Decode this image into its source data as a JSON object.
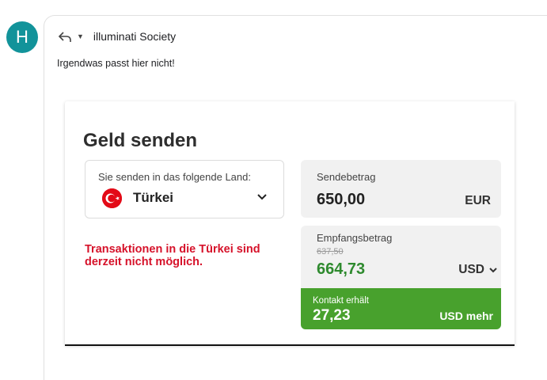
{
  "avatar": {
    "initial": "H",
    "color": "#12939a"
  },
  "header": {
    "recipient": "illuminati Society",
    "reply_icon": "reply-icon",
    "dropdown_icon": "caret-down-icon"
  },
  "message": {
    "text": "Irgendwas passt hier nicht!"
  },
  "transfer": {
    "title": "Geld senden",
    "country_label": "Sie senden in das folgende Land:",
    "country_name": "Türkei",
    "country_flag": "turkey-flag-icon",
    "error": "Transaktionen in die Türkei sind derzeit nicht möglich.",
    "error_color": "#d6122a",
    "send": {
      "label": "Sendebetrag",
      "amount": "650,00",
      "currency": "EUR"
    },
    "receive": {
      "label": "Empfangsbetrag",
      "old_amount": "637,50",
      "amount": "664,73",
      "amount_color": "#2e8a2e",
      "currency": "USD"
    },
    "bonus": {
      "label": "Kontakt erhält",
      "amount": "27,23",
      "more": "USD mehr",
      "color": "#48a12d"
    }
  }
}
